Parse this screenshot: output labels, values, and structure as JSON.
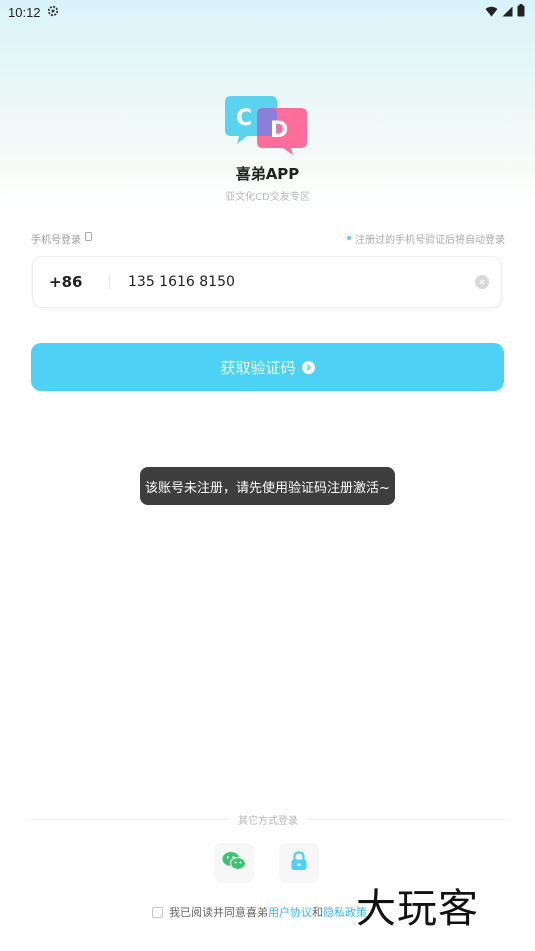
{
  "status_bar": {
    "time": "10:12"
  },
  "app": {
    "name": "喜弟APP",
    "slogan": "亚文化CD交友专区"
  },
  "login": {
    "label": "手机号登录",
    "tip": "注册过的手机号验证后将自动登录",
    "country_code": "+86",
    "phone_value": "135 1616 8150"
  },
  "code_button": {
    "label": "获取验证码"
  },
  "toast": {
    "text": "该账号未注册，请先使用验证码注册激活~"
  },
  "other": {
    "label": "其它方式登录"
  },
  "agreement": {
    "prefix": "我已阅读并同意喜弟",
    "user_link": "用户协议",
    "and": "和",
    "privacy_link": "隐私政策"
  },
  "watermark": {
    "text": "大玩客"
  },
  "colors": {
    "accent": "#4dd1f5",
    "link": "#3bb8e4",
    "wechat": "#3cc56e"
  },
  "icons": [
    "settings-icon",
    "wifi-icon",
    "signal-icon",
    "battery-icon",
    "checkbox-icon",
    "clear-icon",
    "arrow-right-icon",
    "wechat-icon",
    "lock-icon"
  ]
}
